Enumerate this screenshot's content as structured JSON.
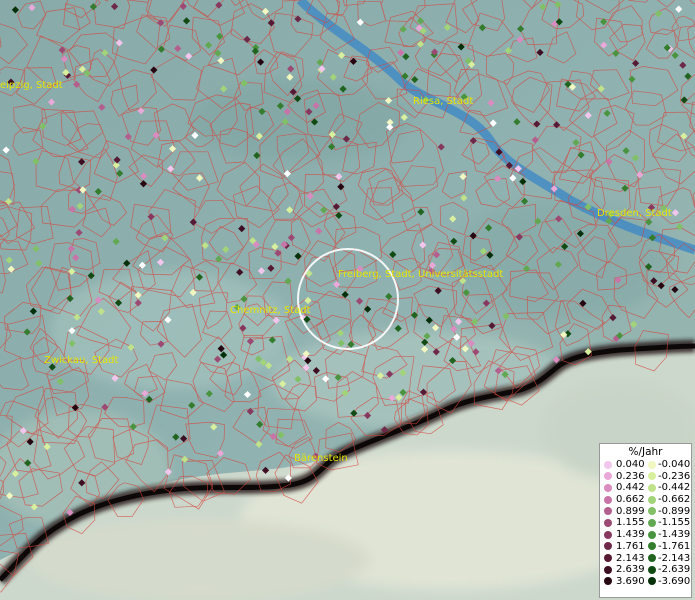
{
  "cities": [
    {
      "id": "leipzig",
      "label": "eipzig, Stadt"
    },
    {
      "id": "riesa",
      "label": "Riesa, Stadt"
    },
    {
      "id": "dresden",
      "label": "Dresden, Stadt"
    },
    {
      "id": "freiberg",
      "label": "Freiberg, Stadt, Universitätsstadt"
    },
    {
      "id": "chemnitz",
      "label": "Chemnitz, Stadt"
    },
    {
      "id": "zwickau",
      "label": "Zwickau, Stadt"
    },
    {
      "id": "baerenstein",
      "label": "Bärenstein"
    }
  ],
  "legend": {
    "title": "%/Jahr",
    "rows": [
      {
        "pos": "0.040",
        "neg": "-0.040",
        "pos_color": "#f2c6ec",
        "neg_color": "#f0f7c0"
      },
      {
        "pos": "0.236",
        "neg": "-0.236",
        "pos_color": "#e8a8d8",
        "neg_color": "#d8ef9e"
      },
      {
        "pos": "0.442",
        "neg": "-0.442",
        "pos_color": "#d98cc0",
        "neg_color": "#bfe28a"
      },
      {
        "pos": "0.662",
        "neg": "-0.662",
        "pos_color": "#c874a8",
        "neg_color": "#a2d47a"
      },
      {
        "pos": "0.899",
        "neg": "-0.899",
        "pos_color": "#b45e8e",
        "neg_color": "#82c068"
      },
      {
        "pos": "1.155",
        "neg": "-1.155",
        "pos_color": "#9c4a74",
        "neg_color": "#62a852"
      },
      {
        "pos": "1.439",
        "neg": "-1.439",
        "pos_color": "#86385e",
        "neg_color": "#4a9440"
      },
      {
        "pos": "1.761",
        "neg": "-1.761",
        "pos_color": "#6e2848",
        "neg_color": "#347c2e"
      },
      {
        "pos": "2.143",
        "neg": "-2.143",
        "pos_color": "#561a34",
        "neg_color": "#216420"
      },
      {
        "pos": "2.639",
        "neg": "-2.639",
        "pos_color": "#3e0e22",
        "neg_color": "#124a14"
      },
      {
        "pos": "3.690",
        "neg": "-3.690",
        "pos_color": "#260610",
        "neg_color": "#06300a"
      }
    ]
  }
}
